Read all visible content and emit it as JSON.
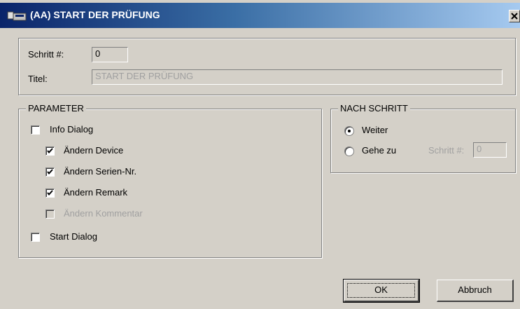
{
  "window": {
    "title": "(AA) START DER PRÜFUNG"
  },
  "step": {
    "label": "Schritt #:",
    "value": "0"
  },
  "titel": {
    "label": "Titel:",
    "value": "START DER PRÜFUNG"
  },
  "parameter": {
    "legend": "PARAMETER",
    "items": [
      {
        "label": "Info Dialog",
        "checked": false,
        "enabled": true
      },
      {
        "label": "Ändern Device",
        "checked": true,
        "enabled": true
      },
      {
        "label": "Ändern Serien-Nr.",
        "checked": true,
        "enabled": true
      },
      {
        "label": "Ändern Remark",
        "checked": true,
        "enabled": true
      },
      {
        "label": "Ändern Kommentar",
        "checked": false,
        "enabled": false
      },
      {
        "label": "Start Dialog",
        "checked": false,
        "enabled": true
      }
    ]
  },
  "nach_schritt": {
    "legend": "NACH SCHRITT",
    "options": [
      {
        "label": "Weiter",
        "selected": true
      },
      {
        "label": "Gehe zu",
        "selected": false
      }
    ],
    "goto_label": "Schritt #:",
    "goto_value": "0"
  },
  "buttons": {
    "ok": "OK",
    "cancel": "Abbruch"
  },
  "icons": {
    "app": "dialog-app-icon",
    "close": "close-icon"
  }
}
